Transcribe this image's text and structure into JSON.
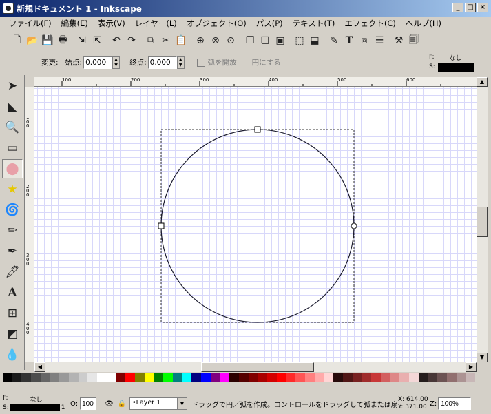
{
  "window": {
    "title": "新規ドキュメント 1 - Inkscape"
  },
  "menu": [
    "ファイル(F)",
    "編集(E)",
    "表示(V)",
    "レイヤー(L)",
    "オブジェクト(O)",
    "パス(P)",
    "テキスト(T)",
    "エフェクト(C)",
    "ヘルプ(H)"
  ],
  "controls": {
    "mode_label": "変更:",
    "start_label": "始点:",
    "start_value": "0.000",
    "end_label": "終点:",
    "end_value": "0.000",
    "open_arc_label": "弧を開放",
    "make_circle_label": "円にする"
  },
  "style_indicator": {
    "fill_label": "F:",
    "fill_value": "なし",
    "stroke_label": "S:"
  },
  "rulers": {
    "horizontal": [
      "100",
      "200",
      "300",
      "400",
      "500",
      "600"
    ],
    "vertical": [
      "100",
      "200",
      "300",
      "400"
    ]
  },
  "palette": [
    "#000000",
    "#1a1a1a",
    "#333333",
    "#4d4d4d",
    "#666666",
    "#808080",
    "#999999",
    "#b3b3b3",
    "#cccccc",
    "#e6e6e6",
    "#ffffff",
    "#ffffff",
    "#800000",
    "#ff0000",
    "#808000",
    "#ffff00",
    "#008000",
    "#00ff00",
    "#008080",
    "#00ffff",
    "#000080",
    "#0000ff",
    "#800080",
    "#ff00ff",
    "#2b0000",
    "#550000",
    "#800000",
    "#aa0000",
    "#d40000",
    "#ff0000",
    "#ff2a2a",
    "#ff5555",
    "#ff8080",
    "#ffaaaa",
    "#ffd5d5",
    "#280b0b",
    "#501616",
    "#782121",
    "#a02c2c",
    "#c83737",
    "#d35f5f",
    "#de8787",
    "#e9afaf",
    "#f4d7d7",
    "#241c1c",
    "#483737",
    "#6c5353",
    "#916f6f",
    "#ac9393",
    "#c8b7b7"
  ],
  "status": {
    "fill_label": "F:",
    "fill_value": "なし",
    "stroke_label": "S:",
    "stroke_width": "1",
    "opacity_label": "O:",
    "opacity_value": "100",
    "layer": "•Layer 1",
    "message": "ドラッグで円／弧を作成。コントロールをドラッグして弧または扇形",
    "x_coord": "X: 614.00",
    "y_coord": "Y: 371.00",
    "zoom_label": "Z:",
    "zoom_value": "100%"
  }
}
